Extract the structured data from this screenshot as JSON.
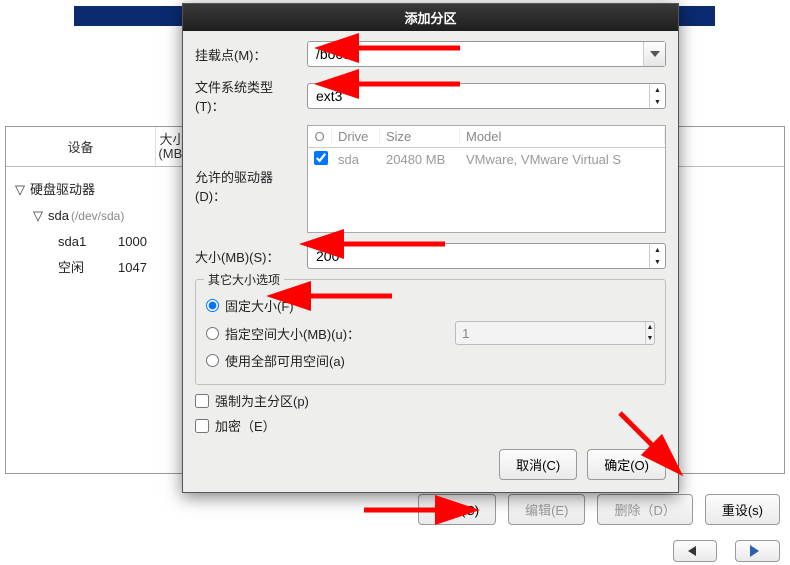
{
  "dialog": {
    "title": "添加分区",
    "mountpoint_label": "挂载点(M)：",
    "mountpoint_value": "/boot",
    "fstype_label": "文件系统类型(T)：",
    "fstype_value": "ext3",
    "allowdrives_label": "允许的驱动器(D)：",
    "drive_headers": {
      "o": "O",
      "drive": "Drive",
      "size": "Size",
      "model": "Model"
    },
    "drive_row": {
      "name": "sda",
      "size": "20480 MB",
      "model": "VMware, VMware Virtual S"
    },
    "size_label": "大小(MB)(S)：",
    "size_value": "200",
    "groupbox_title": "其它大小选项",
    "radio_fixed": "固定大小(F)",
    "radio_specify": "指定空间大小(MB)(u)：",
    "specify_value": "1",
    "radio_all": "使用全部可用空间(a)",
    "force_primary": "强制为主分区(p)",
    "encrypt": "加密（E）",
    "cancel": "取消(C)",
    "ok": "确定(O)"
  },
  "main": {
    "header_device": "设备",
    "header_size": "大小\n(MB)",
    "tree": {
      "harddrives": "硬盘驱动器",
      "sda": "sda",
      "sda_path": "(/dev/sda)",
      "sda1": "sda1",
      "sda1_size": "1000",
      "free": "空闲",
      "free_size": "1047"
    },
    "buttons": {
      "create": "创建(C)",
      "edit": "编辑(E)",
      "delete": "删除（D）",
      "reset": "重设(s)"
    }
  },
  "bottom": {
    "back": "",
    "forward": ""
  }
}
